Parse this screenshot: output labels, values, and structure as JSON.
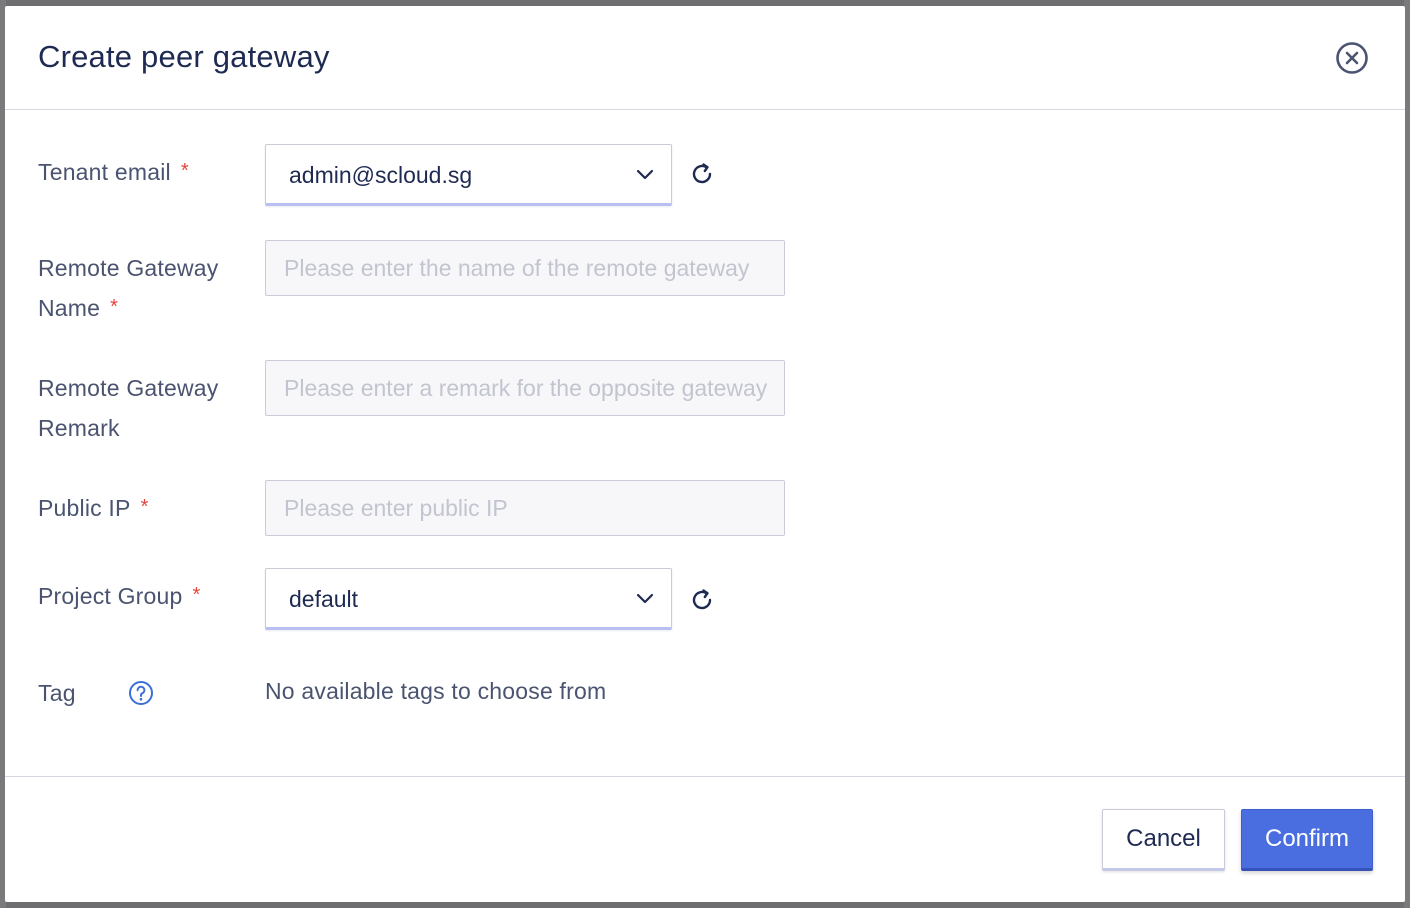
{
  "dialog": {
    "title": "Create peer gateway",
    "close_icon": "close-circle-icon"
  },
  "form": {
    "tenant_email": {
      "label": "Tenant email",
      "required_mark": "*",
      "value": "admin@scloud.sg",
      "refresh_icon": "refresh-icon"
    },
    "remote_gateway_name": {
      "label": "Remote Gateway Name",
      "required_mark": "*",
      "value": "",
      "placeholder": "Please enter the name of the remote gateway"
    },
    "remote_gateway_remark": {
      "label": "Remote Gateway Remark",
      "value": "",
      "placeholder": "Please enter a remark for the opposite gateway"
    },
    "public_ip": {
      "label": "Public IP",
      "required_mark": "*",
      "value": "",
      "placeholder": "Please enter public IP"
    },
    "project_group": {
      "label": "Project Group",
      "required_mark": "*",
      "value": "default",
      "refresh_icon": "refresh-icon"
    },
    "tag": {
      "label": "Tag",
      "help_icon": "question-circle-icon",
      "empty_text": "No available tags to choose from"
    }
  },
  "footer": {
    "cancel_label": "Cancel",
    "confirm_label": "Confirm"
  },
  "colors": {
    "title": "#1e2a52",
    "label": "#4a5470",
    "required": "#e5463a",
    "primary": "#4a6ee0",
    "help_icon": "#3b6fd8"
  }
}
